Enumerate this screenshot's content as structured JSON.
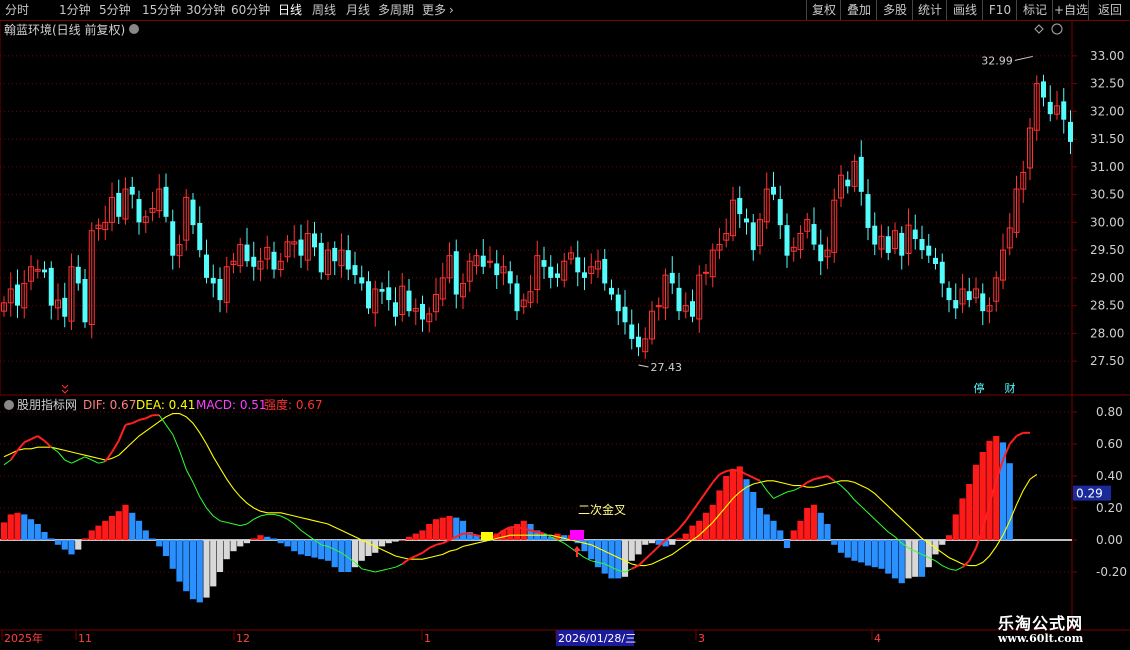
{
  "toolbar": {
    "periods": [
      "分时",
      "1分钟",
      "5分钟",
      "15分钟",
      "30分钟",
      "60分钟",
      "日线",
      "周线",
      "月线",
      "多周期",
      "更多"
    ],
    "active": "日线",
    "more_icon": "chevron-right-icon",
    "right": [
      "复权",
      "叠加",
      "多股",
      "统计",
      "画线",
      "F10",
      "+自选",
      "返回"
    ],
    "right_extra": "标记"
  },
  "main_panel": {
    "title": "翰蓝环境(日线 前复权)",
    "high_label": "32.99",
    "low_label": "27.43",
    "markers": [
      "停",
      "财"
    ],
    "y_ticks": [
      "33.00",
      "32.50",
      "32.00",
      "31.50",
      "31.00",
      "30.50",
      "30.00",
      "29.50",
      "29.00",
      "28.50",
      "28.00",
      "27.50"
    ]
  },
  "indicator_panel": {
    "name": "股朋指标网",
    "dif_label": "DIF: 0.67",
    "dea_label": "DEA: 0.41",
    "macd_label": "MACD: 0.51",
    "strength_label": "强度: 0.67",
    "annotation": "二次金叉",
    "current_value": "0.29",
    "y_ticks": [
      "0.80",
      "0.60",
      "0.40",
      "0.20",
      "0.00",
      "-0.20"
    ]
  },
  "date_axis": {
    "labels": [
      "2025年",
      "11",
      "12",
      "1",
      "2026/01/28/三",
      "3",
      "4"
    ]
  },
  "watermark": {
    "title": "乐淘公式网",
    "url": "www.60lt.com"
  },
  "colors": {
    "up": "#ff3232",
    "down": "#54fcfc",
    "grid": "#7a0000",
    "dif": "#ffffff",
    "dea": "#ffff00",
    "strength": "#ff3232",
    "hist_red": "#ff1a1a",
    "hist_blue": "#2a8fff",
    "hist_white": "#d8d8d8"
  },
  "chart_data": {
    "type": "candlestick",
    "ylim": [
      27.25,
      33.25
    ],
    "closes": [
      28.55,
      28.8,
      28.5,
      28.9,
      29.2,
      29.15,
      29.1,
      28.5,
      28.6,
      28.3,
      29.2,
      28.9,
      28.2,
      29.85,
      29.95,
      30.0,
      30.45,
      30.1,
      30.6,
      30.5,
      30.0,
      30.1,
      30.25,
      30.6,
      30.1,
      29.4,
      29.6,
      30.45,
      29.95,
      29.5,
      29.0,
      28.9,
      28.6,
      29.2,
      29.3,
      29.6,
      29.3,
      29.2,
      29.3,
      29.55,
      29.15,
      29.3,
      29.65,
      29.65,
      29.4,
      29.8,
      29.55,
      29.1,
      29.5,
      29.3,
      29.5,
      29.15,
      29.05,
      28.9,
      28.45,
      28.8,
      28.75,
      28.6,
      28.3,
      28.85,
      28.4,
      28.45,
      28.25,
      28.35,
      28.7,
      29.0,
      29.4,
      28.7,
      28.9,
      29.3,
      29.4,
      29.2,
      29.3,
      29.05,
      29.2,
      28.9,
      28.4,
      28.6,
      28.75,
      29.4,
      29.2,
      29.0,
      29.0,
      29.3,
      29.45,
      29.1,
      29.0,
      29.2,
      29.3,
      28.9,
      28.7,
      28.4,
      28.2,
      27.9,
      27.75,
      27.9,
      28.4,
      28.5,
      29.05,
      28.9,
      28.4,
      28.5,
      28.3,
      29.05,
      29.1,
      29.5,
      29.6,
      29.8,
      30.4,
      30.15,
      30.0,
      29.5,
      30.05,
      30.6,
      30.5,
      29.95,
      29.4,
      29.55,
      29.8,
      30.05,
      29.6,
      29.3,
      29.5,
      30.4,
      30.85,
      30.65,
      31.1,
      30.55,
      29.9,
      29.6,
      29.75,
      29.45,
      29.85,
      29.4,
      29.95,
      29.7,
      29.5,
      29.4,
      29.25,
      28.9,
      28.6,
      28.45,
      28.8,
      28.6,
      28.8,
      28.4,
      28.5,
      29.0,
      29.5,
      29.9,
      30.6,
      30.9,
      31.7,
      32.5,
      32.25,
      31.95,
      32.1,
      31.85,
      31.45
    ],
    "macd_hist": [
      0.11,
      0.16,
      0.17,
      0.16,
      0.13,
      0.1,
      0.05,
      0.01,
      -0.03,
      -0.06,
      -0.09,
      -0.06,
      0.01,
      0.06,
      0.09,
      0.12,
      0.15,
      0.18,
      0.22,
      0.17,
      0.12,
      0.06,
      0.01,
      -0.04,
      -0.1,
      -0.18,
      -0.26,
      -0.32,
      -0.37,
      -0.39,
      -0.36,
      -0.29,
      -0.2,
      -0.12,
      -0.07,
      -0.04,
      -0.02,
      0.01,
      0.03,
      0.02,
      0.01,
      -0.02,
      -0.04,
      -0.07,
      -0.09,
      -0.1,
      -0.11,
      -0.12,
      -0.13,
      -0.17,
      -0.2,
      -0.2,
      -0.17,
      -0.13,
      -0.1,
      -0.08,
      -0.04,
      -0.02,
      -0.01,
      0.0,
      0.02,
      0.04,
      0.06,
      0.1,
      0.13,
      0.14,
      0.15,
      0.14,
      0.12,
      0.05,
      0.03,
      0.01,
      0.0,
      0.04,
      0.06,
      0.08,
      0.1,
      0.12,
      0.1,
      0.06,
      0.04,
      0.02,
      0.04,
      0.03,
      0.03,
      -0.02,
      -0.07,
      -0.12,
      -0.17,
      -0.21,
      -0.24,
      -0.24,
      -0.23,
      -0.13,
      -0.09,
      -0.03,
      -0.02,
      -0.03,
      -0.04,
      -0.03,
      0.01,
      0.04,
      0.09,
      0.12,
      0.17,
      0.22,
      0.31,
      0.4,
      0.44,
      0.46,
      0.38,
      0.3,
      0.2,
      0.16,
      0.12,
      0.06,
      -0.05,
      0.06,
      0.12,
      0.2,
      0.22,
      0.17,
      0.1,
      -0.03,
      -0.08,
      -0.11,
      -0.13,
      -0.14,
      -0.16,
      -0.17,
      -0.18,
      -0.21,
      -0.24,
      -0.27,
      -0.24,
      -0.23,
      -0.23,
      -0.17,
      -0.09,
      -0.03,
      0.03,
      0.16,
      0.26,
      0.35,
      0.47,
      0.55,
      0.62,
      0.65,
      0.61,
      0.48
    ],
    "dif": [
      0.47,
      0.5,
      0.56,
      0.61,
      0.63,
      0.65,
      0.62,
      0.58,
      0.55,
      0.5,
      0.48,
      0.5,
      0.52,
      0.5,
      0.48,
      0.49,
      0.55,
      0.62,
      0.72,
      0.73,
      0.75,
      0.76,
      0.78,
      0.78,
      0.72,
      0.66,
      0.56,
      0.44,
      0.36,
      0.27,
      0.2,
      0.15,
      0.12,
      0.11,
      0.1,
      0.09,
      0.1,
      0.13,
      0.15,
      0.16,
      0.16,
      0.15,
      0.13,
      0.1,
      0.06,
      0.03,
      0.0,
      -0.03,
      -0.04,
      -0.06,
      -0.08,
      -0.11,
      -0.14,
      -0.18,
      -0.19,
      -0.2,
      -0.19,
      -0.18,
      -0.17,
      -0.15,
      -0.12,
      -0.1,
      -0.08,
      -0.05,
      -0.03,
      -0.02,
      0.0,
      0.02,
      0.04,
      0.04,
      0.03,
      0.02,
      0.01,
      0.03,
      0.06,
      0.08,
      0.08,
      0.07,
      0.06,
      0.05,
      0.04,
      0.02,
      0.0,
      -0.02,
      -0.05,
      -0.08,
      -0.11,
      -0.13,
      -0.14,
      -0.15,
      -0.17,
      -0.19,
      -0.2,
      -0.18,
      -0.16,
      -0.12,
      -0.08,
      -0.04,
      0.0,
      0.03,
      0.07,
      0.12,
      0.18,
      0.24,
      0.3,
      0.36,
      0.41,
      0.43,
      0.44,
      0.43,
      0.41,
      0.39,
      0.37,
      0.31,
      0.26,
      0.28,
      0.3,
      0.31,
      0.33,
      0.36,
      0.38,
      0.39,
      0.4,
      0.37,
      0.34,
      0.3,
      0.25,
      0.21,
      0.17,
      0.13,
      0.09,
      0.05,
      0.02,
      -0.02,
      -0.05,
      -0.07,
      -0.09,
      -0.11,
      -0.13,
      -0.16,
      -0.18,
      -0.19,
      -0.17,
      -0.13,
      -0.05,
      0.07,
      0.22,
      0.37,
      0.5,
      0.6,
      0.65,
      0.67,
      0.67
    ],
    "dea": [
      0.52,
      0.54,
      0.56,
      0.57,
      0.57,
      0.58,
      0.58,
      0.58,
      0.57,
      0.56,
      0.55,
      0.54,
      0.53,
      0.52,
      0.51,
      0.5,
      0.51,
      0.53,
      0.57,
      0.61,
      0.65,
      0.68,
      0.71,
      0.74,
      0.77,
      0.79,
      0.79,
      0.77,
      0.73,
      0.67,
      0.6,
      0.52,
      0.45,
      0.38,
      0.32,
      0.27,
      0.23,
      0.2,
      0.18,
      0.17,
      0.17,
      0.17,
      0.16,
      0.15,
      0.14,
      0.13,
      0.12,
      0.11,
      0.1,
      0.08,
      0.06,
      0.04,
      0.02,
      0.0,
      -0.02,
      -0.04,
      -0.06,
      -0.08,
      -0.1,
      -0.11,
      -0.12,
      -0.12,
      -0.12,
      -0.11,
      -0.1,
      -0.09,
      -0.07,
      -0.06,
      -0.04,
      -0.03,
      -0.02,
      -0.01,
      0.0,
      0.01,
      0.02,
      0.03,
      0.03,
      0.03,
      0.03,
      0.03,
      0.03,
      0.03,
      0.02,
      0.01,
      0.0,
      -0.01,
      -0.02,
      -0.03,
      -0.05,
      -0.07,
      -0.09,
      -0.11,
      -0.13,
      -0.15,
      -0.16,
      -0.16,
      -0.15,
      -0.13,
      -0.11,
      -0.09,
      -0.06,
      -0.03,
      0.0,
      0.03,
      0.07,
      0.11,
      0.16,
      0.21,
      0.26,
      0.3,
      0.33,
      0.35,
      0.36,
      0.37,
      0.37,
      0.36,
      0.35,
      0.34,
      0.34,
      0.33,
      0.33,
      0.34,
      0.35,
      0.36,
      0.37,
      0.37,
      0.36,
      0.34,
      0.32,
      0.29,
      0.25,
      0.21,
      0.17,
      0.13,
      0.09,
      0.05,
      0.01,
      -0.02,
      -0.05,
      -0.08,
      -0.11,
      -0.13,
      -0.15,
      -0.16,
      -0.16,
      -0.14,
      -0.1,
      -0.04,
      0.03,
      0.12,
      0.22,
      0.31,
      0.38,
      0.41
    ]
  }
}
